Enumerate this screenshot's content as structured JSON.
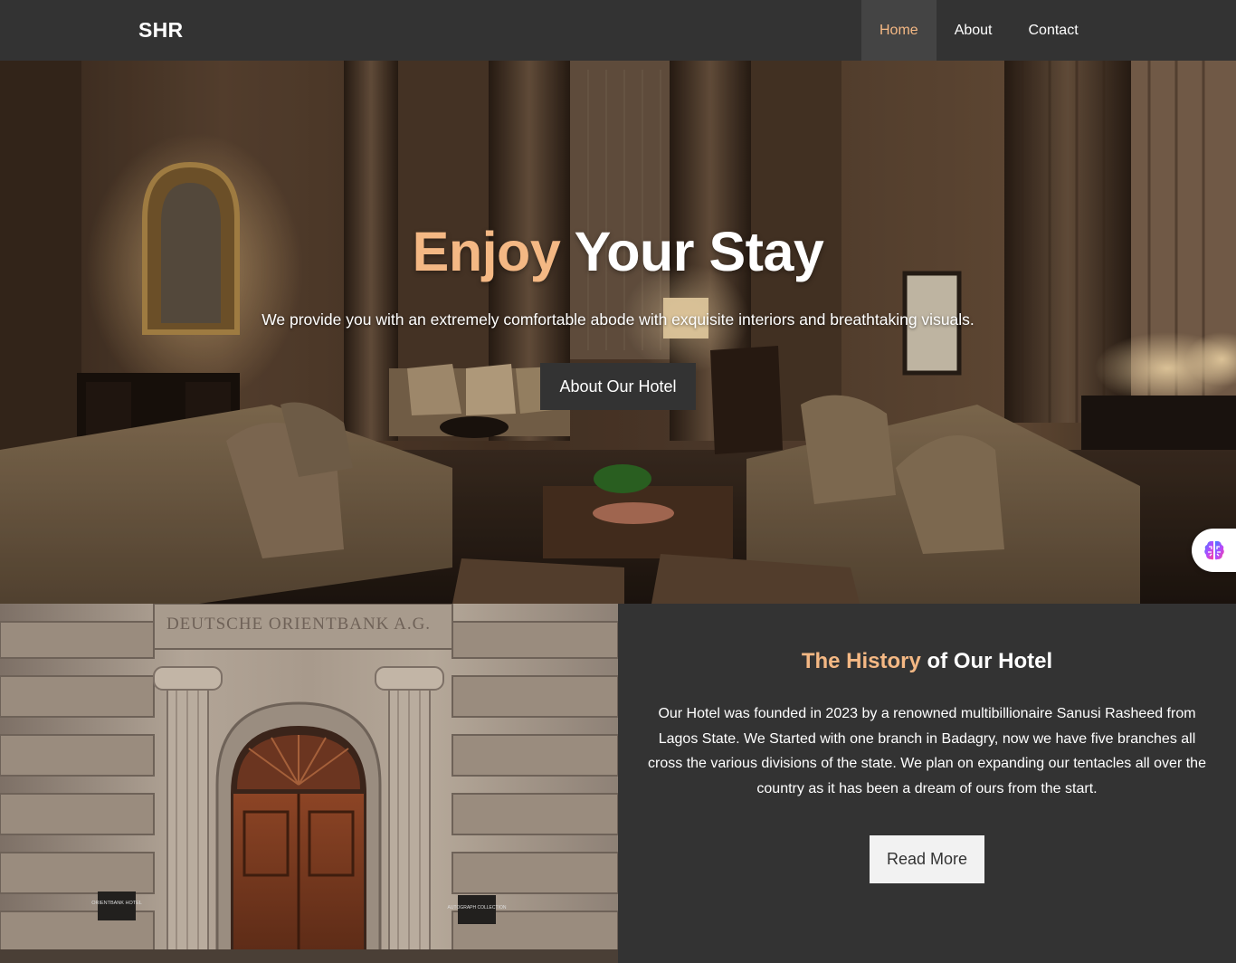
{
  "nav": {
    "brand": "SHR",
    "links": [
      {
        "label": "Home",
        "active": true
      },
      {
        "label": "About",
        "active": false
      },
      {
        "label": "Contact",
        "active": false
      }
    ]
  },
  "hero": {
    "title_accent": "Enjoy",
    "title_rest": "Your Stay",
    "subtitle": "We provide you with an extremely comfortable abode with exquisite interiors and breathtaking visuals.",
    "button_label": "About Our Hotel"
  },
  "history": {
    "title_accent": "The History",
    "title_rest": "of Our Hotel",
    "body": "Our Hotel was founded in 2023 by a renowned multibillionaire Sanusi Rasheed from Lagos State. We Started with one branch in Badagry, now we have five branches all cross the various divisions of the state. We plan on expanding our tentacles all over the country as it has been a dream of ours from the start.",
    "button_label": "Read More",
    "building_inscription": "DEUTSCHE ORIENTBANK A.G.",
    "plaque_left": "ORIENTBANK HOTEL",
    "plaque_right": "AUTOGRAPH COLLECTION"
  },
  "colors": {
    "accent": "#f4b884",
    "dark": "#333333",
    "nav_active_bg": "#444444"
  },
  "icons": {
    "floating_widget": "brain-icon"
  }
}
